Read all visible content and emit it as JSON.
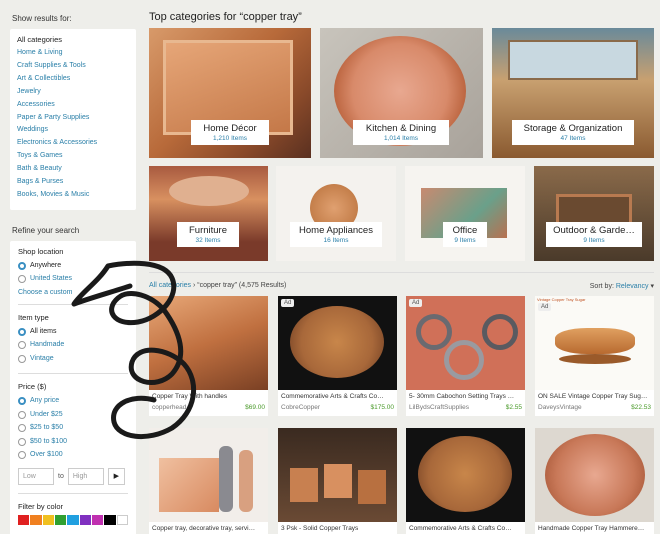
{
  "sidebar": {
    "show_results_label": "Show results for:",
    "all_categories": "All categories",
    "categories": [
      "Home & Living",
      "Craft Supplies & Tools",
      "Art & Collectibles",
      "Jewelry",
      "Accessories",
      "Paper & Party Supplies",
      "Weddings",
      "Electronics & Accessories",
      "Toys & Games",
      "Bath & Beauty",
      "Bags & Purses",
      "Books, Movies & Music"
    ],
    "refine_label": "Refine your search",
    "shop_location": {
      "title": "Shop location",
      "options": [
        "Anywhere",
        "United States"
      ],
      "selected": "Anywhere",
      "custom_link": "Choose a custom"
    },
    "item_type": {
      "title": "Item type",
      "options": [
        "All items",
        "Handmade",
        "Vintage"
      ],
      "selected": "All items"
    },
    "price": {
      "title": "Price ($)",
      "options": [
        "Any price",
        "Under $25",
        "$25 to $50",
        "$50 to $100",
        "Over $100"
      ],
      "selected": "Any price",
      "low_placeholder": "Low",
      "to": "to",
      "high_placeholder": "High",
      "go_icon": "▶"
    },
    "color": {
      "title": "Filter by color",
      "swatches": [
        "#e02020",
        "#f08020",
        "#f0c020",
        "#30a030",
        "#20a0e0",
        "#8030c0",
        "#a030a0",
        "#000000",
        "#ffffff"
      ]
    }
  },
  "main": {
    "title": "Top categories for “copper tray”",
    "top_categories": [
      {
        "name": "Home Décor",
        "count": "1,210 Items"
      },
      {
        "name": "Kitchen & Dining",
        "count": "1,014 Items"
      },
      {
        "name": "Storage & Organization",
        "count": "47 Items"
      },
      {
        "name": "Furniture",
        "count": "32 Items"
      },
      {
        "name": "Home Appliances",
        "count": "16 Items"
      },
      {
        "name": "Office",
        "count": "9 Items"
      },
      {
        "name": "Outdoor & Garde…",
        "count": "9 Items"
      }
    ],
    "breadcrumb": {
      "link": "All categories",
      "sep": "›",
      "query": "“copper tray”",
      "count": "(4,575 Results)"
    },
    "sort": {
      "label": "Sort by:",
      "value": "Relevancy",
      "icon": "▾"
    },
    "listings": [
      {
        "title": "Copper Tray With handles",
        "shop": "copperhead",
        "price": "$69.00",
        "ad": ""
      },
      {
        "title": "Commemorative Arts & Crafts Co…",
        "shop": "CobreCopper",
        "price": "$175.00",
        "ad": "Ad"
      },
      {
        "title": "5- 30mm Cabochon Setting Trays …",
        "shop": "LilBydsCraftSupplies",
        "price": "$2.55",
        "ad": "Ad"
      },
      {
        "title": "ON SALE Vintage Copper Tray Sug…",
        "shop": "DaveysVintage",
        "price": "$22.53",
        "ad": "Ad"
      },
      {
        "title": "Copper tray, decorative tray, servi…",
        "shop": "",
        "price": "",
        "ad": ""
      },
      {
        "title": "3 Psk - Solid Copper Trays",
        "shop": "",
        "price": "",
        "ad": ""
      },
      {
        "title": "Commemorative Arts & Crafts Co…",
        "shop": "",
        "price": "",
        "ad": ""
      },
      {
        "title": "Handmade Copper Tray Hammere…",
        "shop": "",
        "price": "",
        "ad": ""
      }
    ],
    "card4_badge": "Vintage Copper Tray Sugar"
  },
  "overlay": {
    "icon": "handwritten-logo-scribble"
  }
}
